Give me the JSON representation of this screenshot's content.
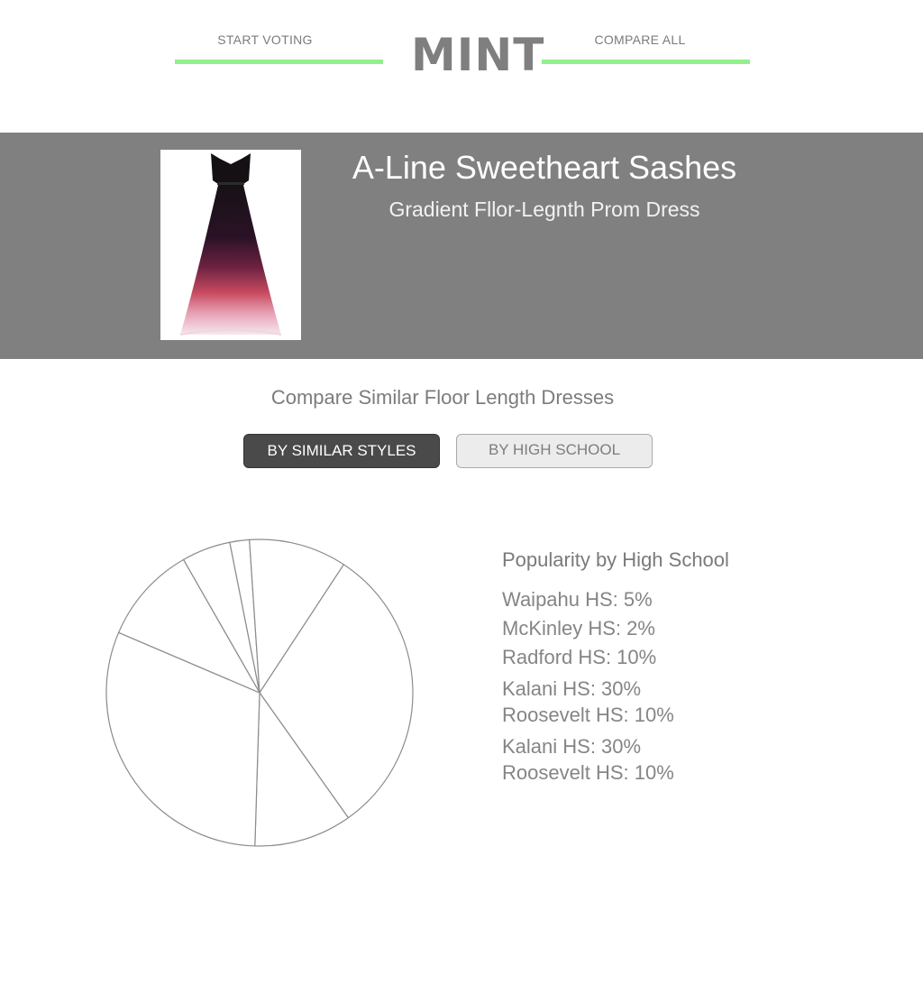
{
  "header": {
    "start_voting": "START VOTING",
    "compare_all": "COMPARE ALL",
    "logo": "MINT",
    "accent_color": "#90f08c"
  },
  "product": {
    "title": "A-Line Sweetheart Sashes",
    "subtitle": "Gradient Fllor-Legnth Prom Dress",
    "image_icon": "dress-image"
  },
  "compare": {
    "heading": "Compare Similar Floor Length Dresses",
    "tab_styles": "BY SIMILAR STYLES",
    "tab_school": "BY HIGH SCHOOL"
  },
  "popularity": {
    "title": "Popularity by High School",
    "items": [
      "Waipahu HS: 5%",
      "McKinley HS: 2%",
      "Radford HS: 10%",
      "Kalani HS: 30%",
      "Roosevelt HS: 10%",
      "Kalani HS: 30%",
      "Roosevelt HS: 10%"
    ]
  },
  "chart_data": {
    "type": "pie",
    "labels": [
      "Waipahu HS",
      "McKinley HS",
      "Radford HS",
      "Kalani HS",
      "Roosevelt HS",
      "Kalani HS",
      "Roosevelt HS"
    ],
    "values": [
      5,
      2,
      10,
      30,
      10,
      30,
      10
    ],
    "title": "Popularity by High School"
  }
}
